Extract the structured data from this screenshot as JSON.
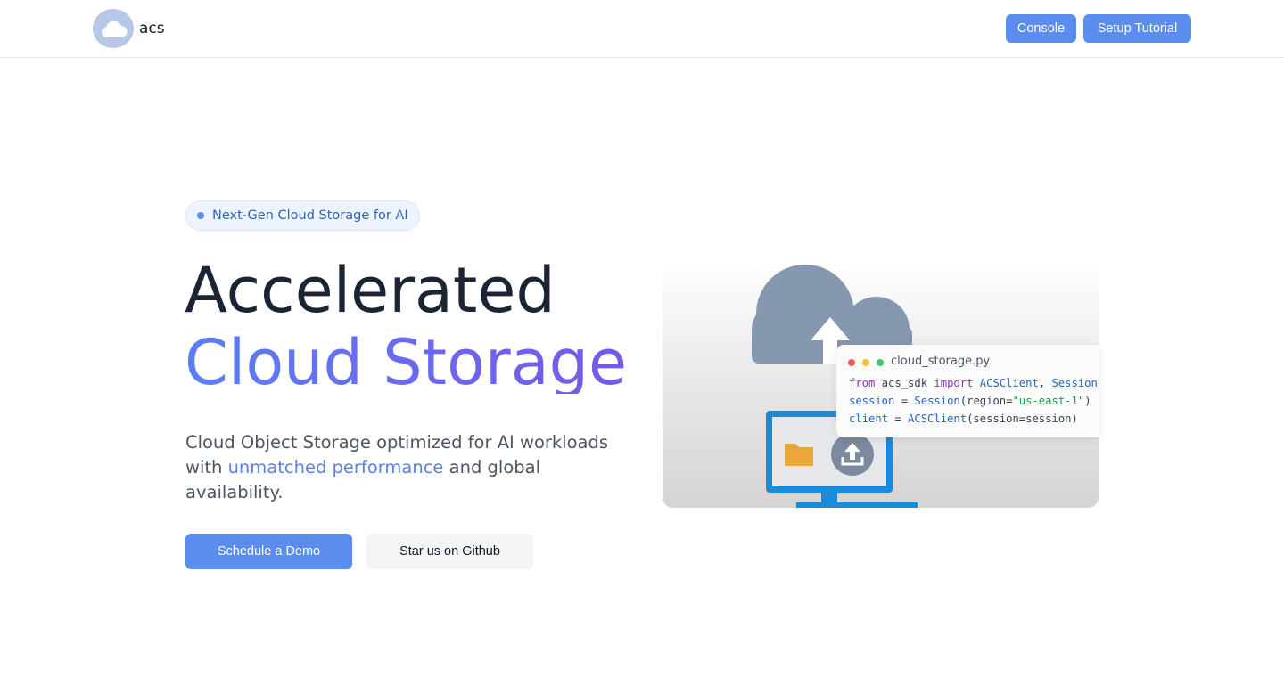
{
  "header": {
    "logo_text": "acs",
    "nav": {
      "console_label": "Console",
      "tutorial_label": "Setup Tutorial"
    }
  },
  "hero": {
    "badge": "Next-Gen Cloud Storage for AI",
    "title_line1": "Accelerated",
    "title_line2": "Cloud Storage",
    "subtitle_pre": "Cloud Object Storage optimized for AI workloads with ",
    "subtitle_highlight": "unmatched performance",
    "subtitle_post": " and global availability.",
    "cta_primary": "Schedule a Demo",
    "cta_secondary": "Star us on Github"
  },
  "code_snippet": {
    "filename": "cloud_storage.py",
    "line1": {
      "kw1": "from",
      "mod": " acs_sdk ",
      "kw2": "import",
      "cls1": " ACSClient",
      "sep": ", ",
      "cls2": "Session"
    },
    "line2": {
      "var": "session",
      "eq": " = ",
      "cls": "Session",
      "open": "(region=",
      "str": "\"us-east-1\"",
      "close": ")"
    },
    "line3": {
      "var": "client",
      "eq": " = ",
      "cls": "ACSClient",
      "rest": "(session=session)"
    },
    "dot_colors": [
      "#ef5b5b",
      "#f5c02b",
      "#3fca6b"
    ]
  },
  "colors": {
    "accent": "#5b8def",
    "gradient_start": "#5b7ff2",
    "gradient_end": "#7657ea"
  },
  "icons": [
    "cloud-icon",
    "cloud-upload-icon",
    "monitor-icon",
    "folder-icon",
    "upload-icon"
  ]
}
